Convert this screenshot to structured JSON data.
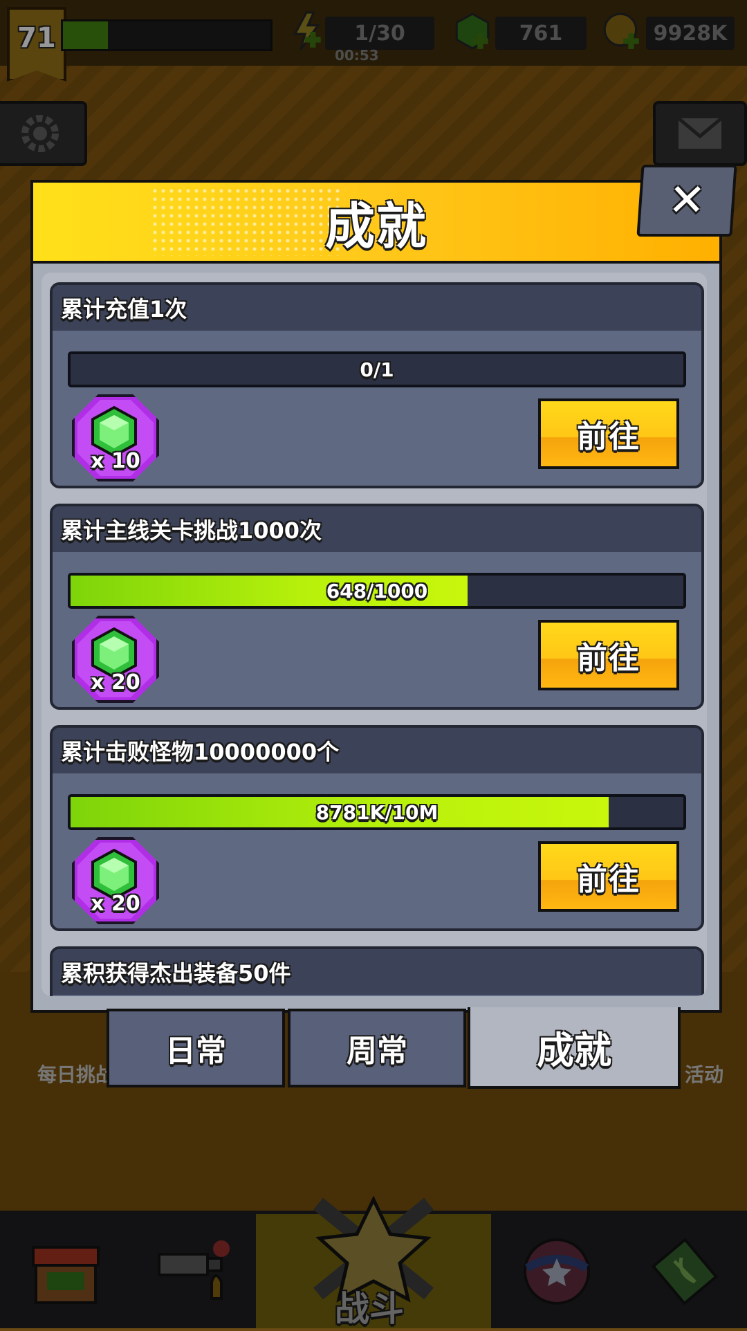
{
  "top_bar": {
    "level": "71",
    "energy": "1/30",
    "energy_timer": "00:53",
    "gems": "761",
    "coins": "9928K"
  },
  "modal": {
    "title": "成就",
    "close_label": "✕"
  },
  "achievements": [
    {
      "title": "累计充值1次",
      "progress_text": "0/1",
      "progress": 0.0,
      "reward_qty": "x 10",
      "button": "前往"
    },
    {
      "title": "累计主线关卡挑战1000次",
      "progress_text": "648/1000",
      "progress": 0.648,
      "reward_qty": "x 20",
      "button": "前往"
    },
    {
      "title": "累计击败怪物10000000个",
      "progress_text": "8781K/10M",
      "progress": 0.878,
      "reward_qty": "x 20",
      "button": "前往"
    },
    {
      "title": "累积获得杰出装备50件"
    }
  ],
  "tabs": [
    {
      "label": "日常",
      "active": false
    },
    {
      "label": "周常",
      "active": false
    },
    {
      "label": "成就",
      "active": true
    }
  ],
  "background": {
    "left_label": "每日挑战",
    "right_label": "活动",
    "nav_battle": "战斗"
  },
  "colors": {
    "header_yellow": "#ffc81a",
    "progress_green": "#b8f10b",
    "gem_purple": "#c44cf5",
    "card_bg": "#606982"
  }
}
